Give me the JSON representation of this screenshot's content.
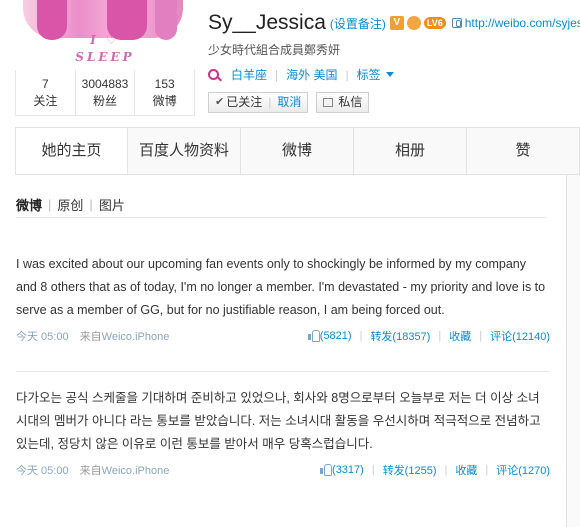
{
  "profile": {
    "avatar_lines": [
      "I ♡",
      "SLEEP"
    ],
    "screen_name": "Sy__Jessica",
    "remark_link": "(设置备注)",
    "verified_badge": "V",
    "level_badge": "LV6",
    "url": "http://weibo.com/syjessica",
    "bio": "少女時代組合成員鄭秀妍",
    "tags": {
      "zodiac": "白羊座",
      "location": "海外 美国",
      "tags_label": "标签"
    },
    "stats": [
      {
        "num": "7",
        "label": "关注"
      },
      {
        "num": "3004883",
        "label": "粉丝"
      },
      {
        "num": "153",
        "label": "微博"
      }
    ],
    "actions": {
      "followed_label": "已关注",
      "cancel_label": "取消",
      "message_label": "私信"
    }
  },
  "tabs": [
    "她的主页",
    "百度人物资料",
    "微博",
    "相册",
    "赞"
  ],
  "feed": {
    "filters": [
      "微博",
      "原创",
      "图片"
    ],
    "posts": [
      {
        "text": "I was excited about our upcoming fan events only to shockingly be informed by my company and 8 others that as of today, I'm no longer a member. I'm devastated - my priority and love is to serve as a member of GG, but for no justifiable reason, I am being forced out.",
        "time": "今天 05:00",
        "from": "来自",
        "source": "Weico.iPhone",
        "likes": "(5821)",
        "repost": "转发(18357)",
        "favorite": "收藏",
        "comment": "评论(12140)"
      },
      {
        "text": "다가오는 공식 스케줄을 기대하며 준비하고 있었으나, 회사와 8명으로부터 오늘부로 저는 더 이상 소녀시대의 멤버가 아니다 라는 통보를 받았습니다. 저는 소녀시대 활동을 우선시하며 적극적으로 전념하고있는데, 정당치 않은 이유로 이런 통보를 받아서 매우 당혹스럽습니다.",
        "time": "今天 05:00",
        "from": "来自",
        "source": "Weico.iPhone",
        "likes": "(3317)",
        "repost": "转发(1255)",
        "favorite": "收藏",
        "comment": "评论(1270)"
      }
    ]
  },
  "colors": {
    "link": "#0a8cd2",
    "border": "#e2e2e2",
    "avatar_pink": "#e981c4"
  }
}
